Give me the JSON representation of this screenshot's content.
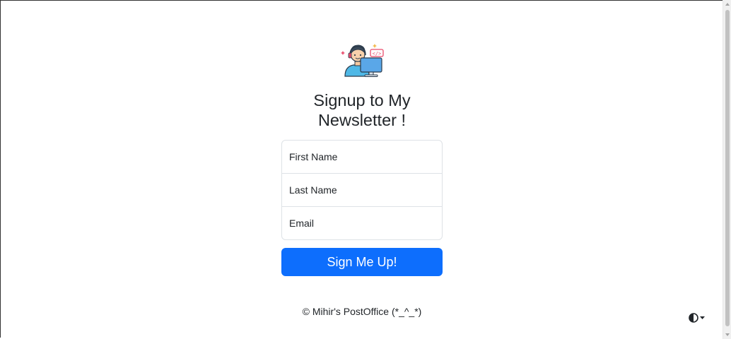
{
  "header": {
    "title": "Signup to My Newsletter !"
  },
  "form": {
    "first_name_placeholder": "First Name",
    "last_name_placeholder": "Last Name",
    "email_placeholder": "Email",
    "submit_label": "Sign Me Up!"
  },
  "footer": {
    "text": "© Mihir's PostOffice (*_^_*)"
  },
  "icons": {
    "logo": "developer-avatar-icon",
    "theme_toggle": "contrast-half-circle-icon",
    "theme_caret": "caret-down-icon"
  },
  "colors": {
    "primary": "#0d6efd",
    "text": "#212529",
    "border": "#dee2e6",
    "background": "#ffffff"
  }
}
